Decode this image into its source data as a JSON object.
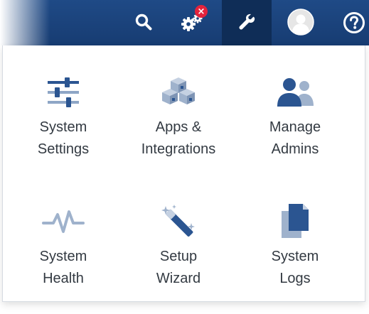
{
  "toolbar": {
    "search_icon": "search-icon",
    "settings_icon": "gears-icon",
    "notification_badge": "×",
    "tools_icon": "wrench-icon",
    "avatar_icon": "user-avatar-icon",
    "help_icon": "help-icon"
  },
  "menu": {
    "items": [
      {
        "label": "System\nSettings",
        "icon": "sliders-icon"
      },
      {
        "label": "Apps &\nIntegrations",
        "icon": "cubes-icon"
      },
      {
        "label": "Manage\nAdmins",
        "icon": "users-icon"
      },
      {
        "label": "System\nHealth",
        "icon": "heartbeat-icon"
      },
      {
        "label": "Setup\nWizard",
        "icon": "magic-wand-icon"
      },
      {
        "label": "System\nLogs",
        "icon": "documents-icon"
      }
    ]
  },
  "colors": {
    "topbar": "#1b437c",
    "active_tab": "#0f2d57",
    "icon_dark": "#2b5591",
    "icon_light": "#9fb2cc",
    "badge": "#e3233c",
    "label_text": "#333a42"
  }
}
